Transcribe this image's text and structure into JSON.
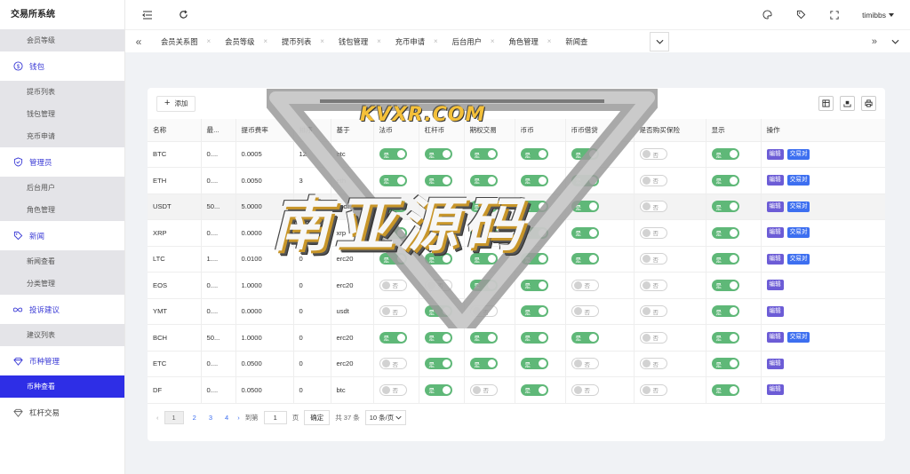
{
  "app": {
    "title": "交易所系统"
  },
  "sidebar": {
    "top_sub": [
      "会员等级"
    ],
    "groups": [
      {
        "label": "钱包",
        "icon": "dollar-circle-icon",
        "items": [
          "提币列表",
          "钱包管理",
          "充币申请"
        ]
      },
      {
        "label": "管理员",
        "icon": "shield-check-icon",
        "items": [
          "后台用户",
          "角色管理"
        ]
      },
      {
        "label": "新闻",
        "icon": "tag-icon",
        "items": [
          "新闻查看",
          "分类管理"
        ]
      },
      {
        "label": "投诉建议",
        "icon": "infinity-icon",
        "items": [
          "建议列表"
        ]
      },
      {
        "label": "币种管理",
        "icon": "diamond-icon",
        "items": [
          "币种查看"
        ]
      }
    ],
    "active_item": "币种查看",
    "plain": {
      "label": "杠杆交易",
      "icon": "diamond-icon"
    }
  },
  "header": {
    "user": "timibbs"
  },
  "tabs": [
    "会员关系图",
    "会员等级",
    "提币列表",
    "钱包管理",
    "充币申请",
    "后台用户",
    "角色管理",
    "新闻查"
  ],
  "toolbar": {
    "add_label": "添加"
  },
  "table": {
    "columns": [
      "名称",
      "最...",
      "提币费率",
      "排序",
      "基于",
      "法币",
      "杠杆币",
      "期权交易",
      "币币",
      "币币借贷",
      "是否购买保险",
      "显示",
      "操作"
    ],
    "on_label": "是",
    "off_label": "否",
    "edit_label": "编辑",
    "pair_label": "交易对",
    "rows": [
      {
        "name": "BTC",
        "min": "0....",
        "fee": "0.0005",
        "sort": "12",
        "base": "btc",
        "sw": [
          1,
          1,
          1,
          1,
          1,
          0,
          1
        ],
        "pair": true
      },
      {
        "name": "ETH",
        "min": "0....",
        "fee": "0.0050",
        "sort": "3",
        "base": "eth",
        "sw": [
          1,
          1,
          1,
          1,
          1,
          0,
          1
        ],
        "pair": true
      },
      {
        "name": "USDT",
        "min": "50...",
        "fee": "5.0000",
        "sort": "0",
        "base": "usdt",
        "sw": [
          1,
          1,
          1,
          1,
          1,
          0,
          1
        ],
        "pair": true
      },
      {
        "name": "XRP",
        "min": "0....",
        "fee": "0.0000",
        "sort": "0",
        "base": "xrp",
        "sw": [
          1,
          1,
          1,
          1,
          1,
          0,
          1
        ],
        "pair": true
      },
      {
        "name": "LTC",
        "min": "1....",
        "fee": "0.0100",
        "sort": "0",
        "base": "erc20",
        "sw": [
          1,
          1,
          1,
          1,
          1,
          0,
          1
        ],
        "pair": true
      },
      {
        "name": "EOS",
        "min": "0....",
        "fee": "1.0000",
        "sort": "0",
        "base": "erc20",
        "sw": [
          0,
          0,
          1,
          1,
          0,
          0,
          1
        ],
        "pair": false
      },
      {
        "name": "YMT",
        "min": "0....",
        "fee": "0.0000",
        "sort": "0",
        "base": "usdt",
        "sw": [
          0,
          1,
          0,
          1,
          0,
          0,
          1
        ],
        "pair": false
      },
      {
        "name": "BCH",
        "min": "50...",
        "fee": "1.0000",
        "sort": "0",
        "base": "erc20",
        "sw": [
          1,
          1,
          1,
          1,
          1,
          0,
          1
        ],
        "pair": true
      },
      {
        "name": "ETC",
        "min": "0....",
        "fee": "0.0500",
        "sort": "0",
        "base": "erc20",
        "sw": [
          0,
          1,
          1,
          1,
          0,
          0,
          1
        ],
        "pair": false
      },
      {
        "name": "DF",
        "min": "0....",
        "fee": "0.0500",
        "sort": "0",
        "base": "btc",
        "sw": [
          0,
          1,
          0,
          1,
          0,
          0,
          1
        ],
        "pair": false
      }
    ]
  },
  "pagination": {
    "pages": [
      "1",
      "2",
      "3",
      "4"
    ],
    "current": "1",
    "goto_label": "到第",
    "page_unit": "页",
    "input_value": "1",
    "confirm_label": "确定",
    "total_label": "共 37 条",
    "page_size": "10 条/页"
  },
  "watermark": {
    "site": "KVXR.COM",
    "text": "南亚源码"
  }
}
